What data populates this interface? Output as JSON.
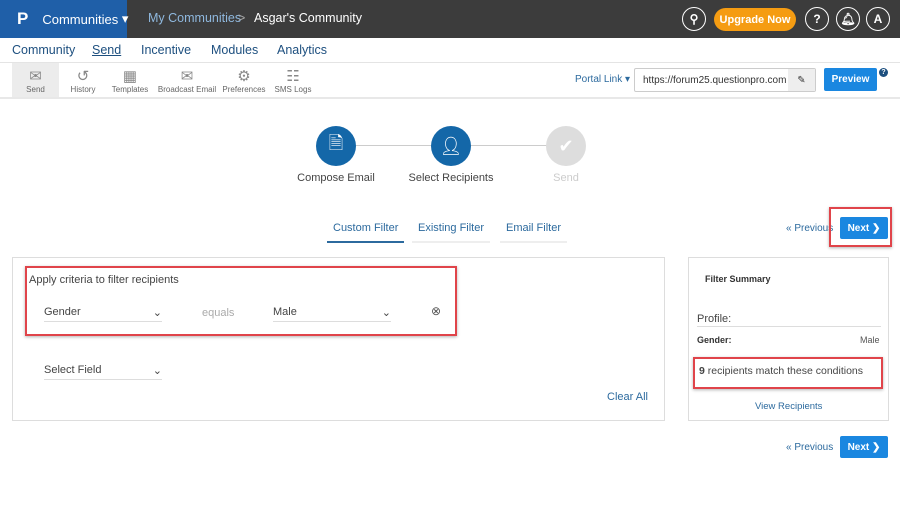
{
  "header": {
    "logo": "P",
    "app": "Communities",
    "breadcrumb_root": "My Communities",
    "breadcrumb_sep": ">",
    "breadcrumb_current": "Asgar's Community",
    "upgrade": "Upgrade Now",
    "help": "?",
    "avatar": "A"
  },
  "nav": [
    "Community",
    "Send",
    "Incentive",
    "Modules",
    "Analytics"
  ],
  "toolbar": {
    "items": [
      "Send",
      "History",
      "Templates",
      "Broadcast Email",
      "Preferences",
      "SMS Logs"
    ],
    "portal_link": "Portal Link",
    "portal_url": "https://forum25.questionpro.com",
    "preview": "Preview",
    "help": "?"
  },
  "steps": [
    {
      "label": "Compose Email",
      "state": "done"
    },
    {
      "label": "Select Recipients",
      "state": "active"
    },
    {
      "label": "Send",
      "state": "pending"
    }
  ],
  "tabs": [
    "Custom Filter",
    "Existing Filter",
    "Email Filter"
  ],
  "pager": {
    "previous": "« Previous",
    "next": "Next ❯"
  },
  "filter": {
    "title": "Apply criteria to filter recipients",
    "field": "Gender",
    "operator": "equals",
    "value": "Male",
    "select_field": "Select Field",
    "clear_all": "Clear All"
  },
  "summary": {
    "title": "Filter Summary",
    "profile": "Profile:",
    "key": "Gender:",
    "value": "Male",
    "count": "9",
    "match_text": "recipients match these conditions",
    "view": "View Recipients"
  },
  "colors": {
    "brand": "#1f5fa8",
    "accent": "#1a87e0",
    "upgrade": "#f59c12",
    "highlight": "#e0444a"
  }
}
